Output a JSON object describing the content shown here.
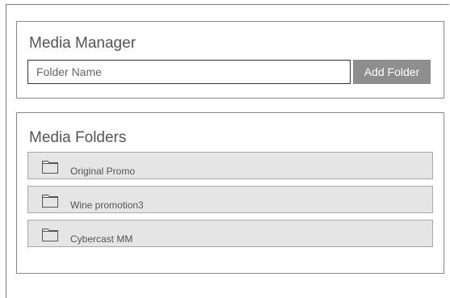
{
  "media_manager": {
    "title": "Media Manager",
    "folder_input": {
      "placeholder": "Folder Name",
      "value": ""
    },
    "add_folder_label": "Add Folder"
  },
  "media_folders": {
    "title": "Media Folders",
    "items": [
      {
        "label": "Original Promo",
        "icon": "folder-icon"
      },
      {
        "label": "Wine promotion3",
        "icon": "folder-icon"
      },
      {
        "label": "Cybercast MM",
        "icon": "folder-icon"
      }
    ]
  },
  "colors": {
    "button_background": "#8e8e8e",
    "row_background": "#e5e5e5",
    "border": "#8a8a8a",
    "text": "#555555"
  }
}
